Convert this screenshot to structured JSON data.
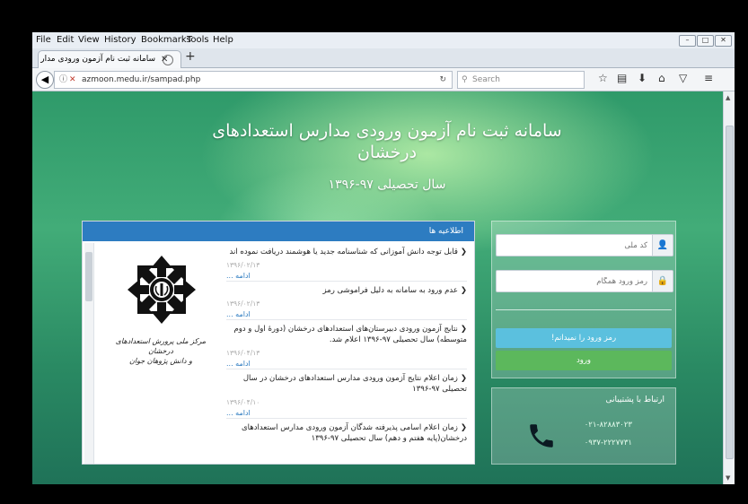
{
  "menu": [
    "File",
    "Edit",
    "View",
    "History",
    "Bookmarks",
    "Tools",
    "Help"
  ],
  "tab": {
    "title": "سامانه ثبت نام آزمون ورودی مدار"
  },
  "nav": {
    "url": "azmoon.medu.ir/sampad.php",
    "search_placeholder": "Search"
  },
  "page": {
    "title": "سامانه ثبت نام آزمون ورودی مدارس استعدادهای درخشان",
    "subtitle": "سال تحصیلی ۹۷-۱۳۹۶"
  },
  "news": {
    "header": "اطلاعیه ها",
    "more_label": "ادامه ...",
    "items": [
      {
        "title": "قابل توجه دانش آموزانی که شناسنامه جدید یا هوشمند دریافت نموده اند",
        "date": "۱۳۹۶/۰۲/۱۳"
      },
      {
        "title": "عدم ورود به سامانه به دلیل فراموشی رمز",
        "date": "۱۳۹۶/۰۲/۱۳"
      },
      {
        "title": "نتایج آزمون ورودی دبیرستان‌های استعدادهای درخشان (دورهٔ اول و دوم متوسطه) سال تحصیلی ۹۷-۱۳۹۶ اعلام شد.",
        "date": "۱۳۹۶/۰۴/۱۳"
      },
      {
        "title": "زمان اعلام نتایج آزمون ورودی مدارس استعدادهای درخشان در سال تحصیلی ۹۷-۱۳۹۶",
        "date": "۱۳۹۶/۰۴/۱۰"
      },
      {
        "title": "زمان اعلام اسامی پذیرفته شدگان آزمون ورودی مدارس استعدادهای درخشان(پایه هفتم و دهم) سال تحصیلی ۹۷-۱۳۹۶",
        "date": ""
      }
    ],
    "logo_caption_1": "مرکز ملی پرورش استعدادهای درخشان",
    "logo_caption_2": "و دانش پژوهان جوان"
  },
  "login": {
    "national_code_placeholder": "کد ملی",
    "password_placeholder": "رمز ورود همگام",
    "forgot_label": "رمز ورود را نمیدانم!",
    "login_label": "ورود"
  },
  "support": {
    "title": "ارتباط با پشتیبانی",
    "phone1": "۰۲۱-۸۲۸۸۳۰۲۳",
    "phone2": "۰۹۳۷-۲۲۲۷۷۳۱"
  },
  "colors": {
    "header_blue": "#2d7cc1",
    "forgot_btn": "#5bc0de",
    "login_btn": "#5cb85c"
  }
}
